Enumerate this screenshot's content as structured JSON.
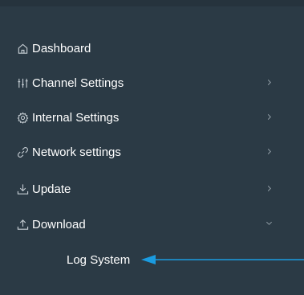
{
  "sidebar": {
    "items": [
      {
        "label": "Dashboard",
        "icon": "home-icon",
        "has_chevron": false
      },
      {
        "label": "Channel Settings",
        "icon": "sliders-icon",
        "chevron": "chevron-right-icon"
      },
      {
        "label": "Internal Settings",
        "icon": "gear-icon",
        "chevron": "chevron-right-icon"
      },
      {
        "label": "Network settings",
        "icon": "link-icon",
        "chevron": "chevron-right-icon"
      },
      {
        "label": "Update",
        "icon": "download-icon",
        "chevron": "chevron-right-icon"
      },
      {
        "label": "Download",
        "icon": "upload-icon",
        "chevron": "chevron-down-icon",
        "expanded": true
      }
    ],
    "subitems": [
      {
        "label": "Log System"
      }
    ]
  },
  "colors": {
    "sidebar_bg": "#2b3a45",
    "text": "#ffffff",
    "icon": "#c6ced4",
    "chevron": "#9aa6ae",
    "annotation_arrow": "#1a9be0"
  }
}
